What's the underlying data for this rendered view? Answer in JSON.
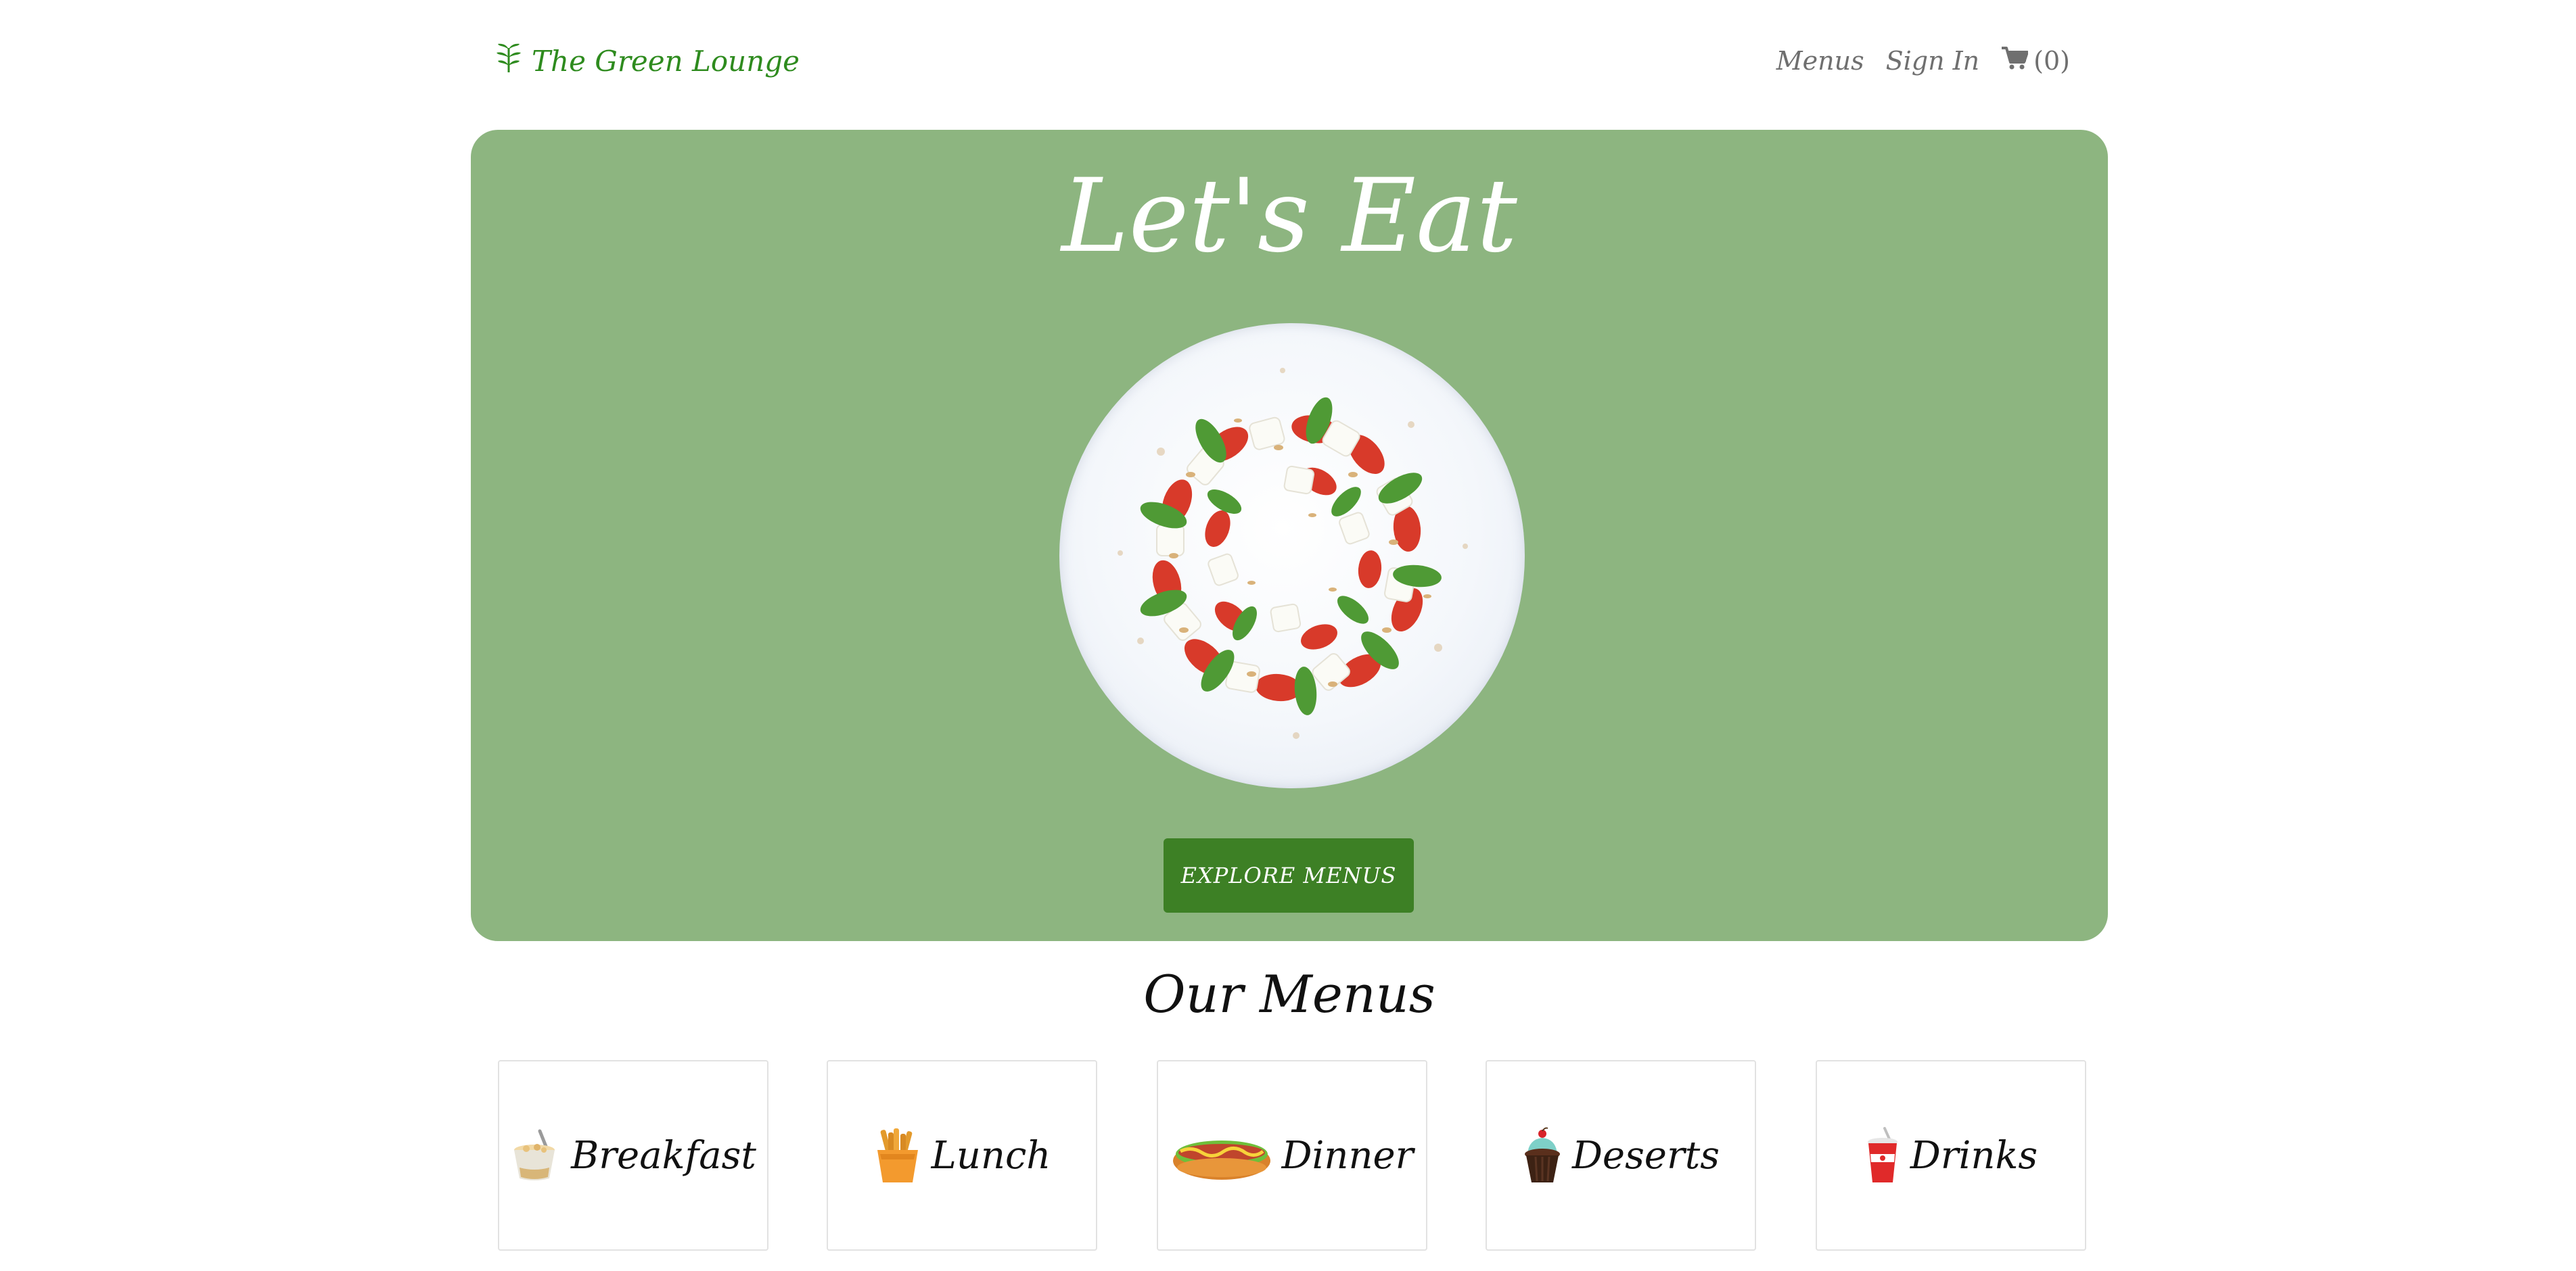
{
  "navbar": {
    "brand": "The Green Lounge",
    "brand_icon": "leaf-icon",
    "links": [
      "Menus",
      "Sign In"
    ],
    "cart_icon": "shopping-cart-icon",
    "cart_count": "(0)"
  },
  "hero": {
    "title": "Let's Eat",
    "image": "caprese-salad-plate",
    "button_label": "EXPLORE MENUS",
    "background": "#8db580",
    "button_color": "#3d8025"
  },
  "menus": {
    "title": "Our Menus",
    "items": [
      {
        "label": "Breakfast",
        "icon": "cereal-bowl-icon"
      },
      {
        "label": "Lunch",
        "icon": "fries-basket-icon"
      },
      {
        "label": "Dinner",
        "icon": "hotdog-icon"
      },
      {
        "label": "Deserts",
        "icon": "cupcake-icon"
      },
      {
        "label": "Drinks",
        "icon": "soda-cup-icon"
      }
    ]
  },
  "colors": {
    "brand": "#2e8b1e",
    "nav_text": "#6f6f6f"
  }
}
